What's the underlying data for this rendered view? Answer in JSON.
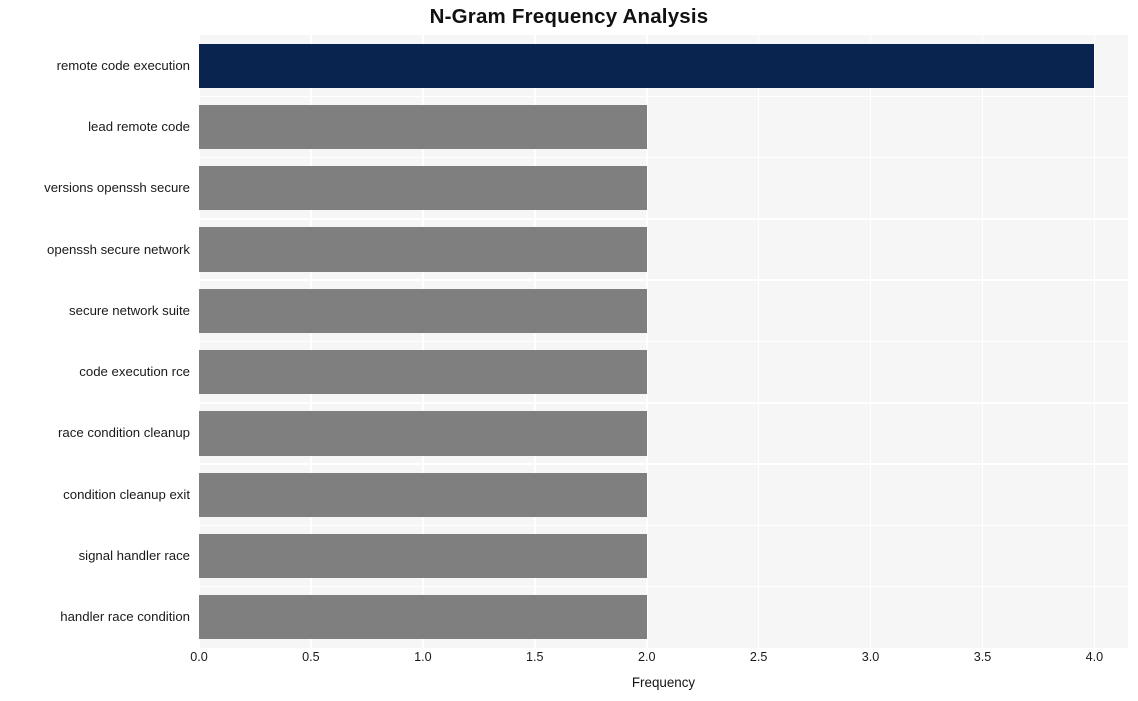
{
  "chart_data": {
    "type": "bar",
    "orientation": "horizontal",
    "title": "N-Gram Frequency Analysis",
    "xlabel": "Frequency",
    "ylabel": "",
    "categories": [
      "remote code execution",
      "lead remote code",
      "versions openssh secure",
      "openssh secure network",
      "secure network suite",
      "code execution rce",
      "race condition cleanup",
      "condition cleanup exit",
      "signal handler race",
      "handler race condition"
    ],
    "values": [
      4,
      2,
      2,
      2,
      2,
      2,
      2,
      2,
      2,
      2
    ],
    "xlim": [
      0,
      4.15
    ],
    "xticks": [
      "0.0",
      "0.5",
      "1.0",
      "1.5",
      "2.0",
      "2.5",
      "3.0",
      "3.5",
      "4.0"
    ],
    "xtick_values": [
      0,
      0.5,
      1,
      1.5,
      2,
      2.5,
      3,
      3.5,
      4
    ],
    "grid": true,
    "legend": false,
    "bar_colors": [
      "#0a2450",
      "#7f7f7f",
      "#7f7f7f",
      "#7f7f7f",
      "#7f7f7f",
      "#7f7f7f",
      "#7f7f7f",
      "#7f7f7f",
      "#7f7f7f",
      "#7f7f7f"
    ],
    "highlight_color": "#0a2450",
    "default_color": "#7f7f7f",
    "plot_background": "#f6f6f7",
    "grid_color": "#ffffff",
    "figure_background": "#ffffff"
  }
}
